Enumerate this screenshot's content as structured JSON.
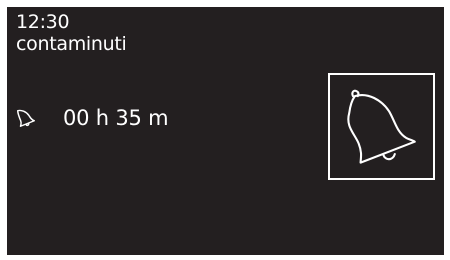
{
  "status": {
    "time": "12:30"
  },
  "mode": {
    "title": "contaminuti"
  },
  "timer": {
    "icon": "bell-icon",
    "value": "00 h 35 m"
  },
  "bell_button": {
    "icon": "bell-icon"
  },
  "colors": {
    "background": "#231f20",
    "foreground": "#ffffff"
  }
}
